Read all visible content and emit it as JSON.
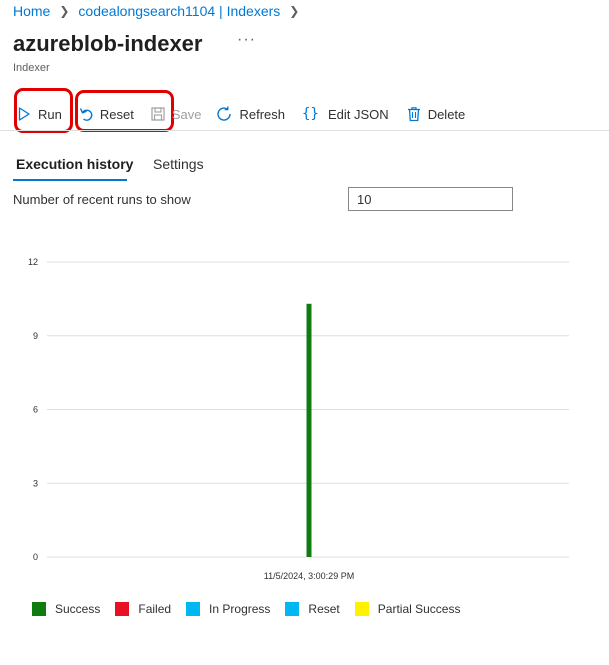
{
  "breadcrumb": {
    "home": "Home",
    "service": "codealongsearch1104 | Indexers"
  },
  "page": {
    "title": "azureblob-indexer",
    "more": "···",
    "subtitle": "Indexer"
  },
  "toolbar": {
    "run": "Run",
    "reset": "Reset",
    "save": "Save",
    "refresh": "Refresh",
    "edit_json": "Edit JSON",
    "delete": "Delete"
  },
  "tabs": {
    "execution_history": "Execution history",
    "settings": "Settings"
  },
  "runs": {
    "label": "Number of recent runs to show",
    "value": "10"
  },
  "colors": {
    "accent": "#0078d4",
    "highlight": "#e00000"
  },
  "chart_data": {
    "type": "bar",
    "categories": [
      "11/5/2024, 3:00:29 PM"
    ],
    "series": [
      {
        "name": "Success",
        "color": "#107c10",
        "values": [
          10.3
        ]
      },
      {
        "name": "Failed",
        "color": "#e81123",
        "values": [
          0
        ]
      },
      {
        "name": "In Progress",
        "color": "#00b7f1",
        "values": [
          0
        ]
      },
      {
        "name": "Reset",
        "color": "#00b7f1",
        "values": [
          0
        ]
      },
      {
        "name": "Partial Success",
        "color": "#fff100",
        "values": [
          0
        ]
      }
    ],
    "yticks": [
      "0",
      "3",
      "6",
      "9",
      "12"
    ],
    "ylim": [
      0,
      12
    ],
    "grid": true,
    "legend_position": "bottom"
  }
}
